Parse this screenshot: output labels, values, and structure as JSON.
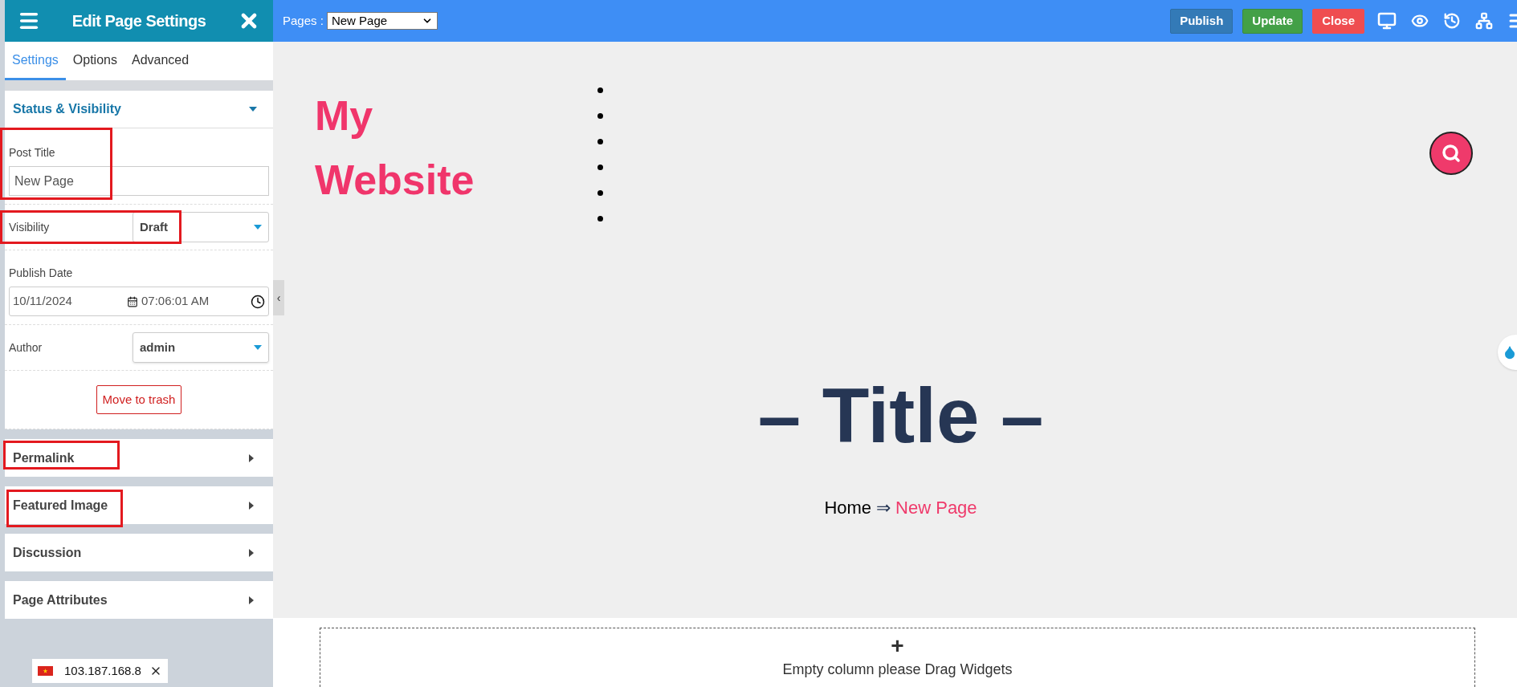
{
  "sidebar": {
    "title": "Edit Page Settings",
    "tabs": [
      {
        "label": "Settings",
        "selected": true
      },
      {
        "label": "Options",
        "selected": false
      },
      {
        "label": "Advanced",
        "selected": false
      }
    ],
    "status_section": {
      "title": "Status & Visibility",
      "expanded": true,
      "post_title": {
        "label": "Post Title",
        "value": "New Page",
        "highlighted": true
      },
      "visibility": {
        "label": "Visibility",
        "value": "Draft",
        "highlighted": true
      },
      "publish_date": {
        "label": "Publish Date",
        "date": "10/11/2024",
        "time": "07:06:01  AM"
      },
      "author": {
        "label": "Author",
        "value": "admin"
      },
      "trash_button": "Move to trash"
    },
    "sections": [
      {
        "title": "Permalink",
        "expanded": false,
        "highlighted": true
      },
      {
        "title": "Featured Image",
        "expanded": false,
        "highlighted": true
      },
      {
        "title": "Discussion",
        "expanded": false,
        "highlighted": false
      },
      {
        "title": "Page Attributes",
        "expanded": false,
        "highlighted": false
      }
    ],
    "ip_badge": "103.187.168.8"
  },
  "collapse_handle": "‹",
  "top_bar": {
    "pages_label": "Pages :",
    "page_select": "New Page",
    "buttons": [
      {
        "label": "Publish",
        "kind": "publish"
      },
      {
        "label": "Update",
        "kind": "update"
      },
      {
        "label": "Close",
        "kind": "close"
      }
    ]
  },
  "canvas": {
    "logo": "My Website",
    "nav_items": [
      {
        "kind": "bullet"
      },
      {
        "kind": "bullet"
      },
      {
        "kind": "bullet"
      },
      {
        "kind": "bullet"
      },
      {
        "kind": "bullet"
      },
      {
        "kind": "bullet"
      }
    ],
    "page_title": "– Title –",
    "breadcrumb": {
      "home": "Home",
      "separator": "⇒",
      "current": "New Page"
    },
    "empty_column": {
      "plus": "+",
      "text": "Empty column please Drag Widgets"
    }
  }
}
